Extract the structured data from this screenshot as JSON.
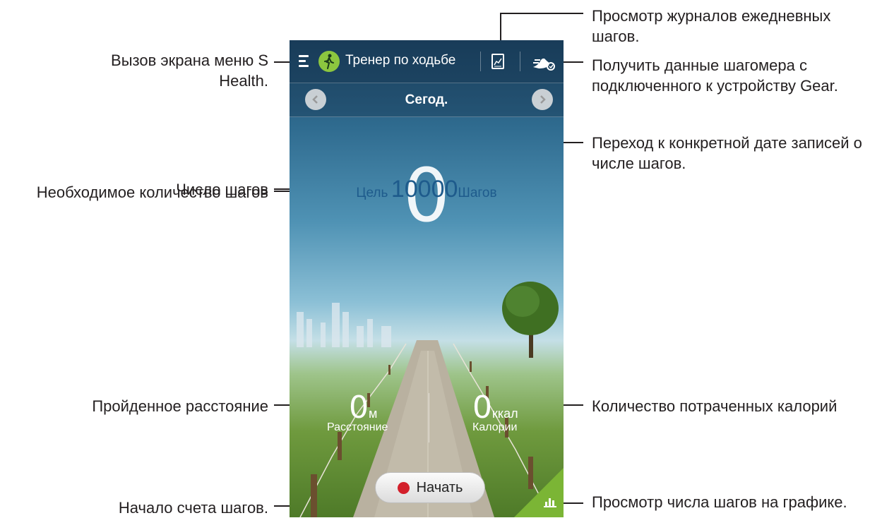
{
  "app": {
    "title": "Тренер по ходьбе",
    "date": "Сегод.",
    "step_count": "0",
    "goal_prefix": "Цель",
    "goal_value": "10000",
    "goal_unit": "Шагов",
    "distance_value": "0",
    "distance_unit": "м",
    "distance_label": "Расстояние",
    "calories_value": "0",
    "calories_unit": "ккал",
    "calories_label": "Калории",
    "start_label": "Начать",
    "prev_icon": "chevron-left-icon",
    "next_icon": "chevron-right-icon",
    "colors": {
      "accent_green": "#8cc63f",
      "record_red": "#d3202b",
      "goal_blue": "#1e5b8c"
    }
  },
  "annotations": {
    "menu": "Вызов экрана меню S Health.",
    "log": "Просмотр журналов ежедневных шагов.",
    "gear": "Получить данные шагомера с подключенного к устройству Gear.",
    "date": "Переход к конкретной дате записей о числе шагов.",
    "steps": "Число шагов",
    "goal": "Необходимое количество шагов",
    "distance": "Пройденное расстояние",
    "calories": "Количество потраченных калорий",
    "start": "Начало счета шагов.",
    "chart": "Просмотр числа шагов на графике."
  }
}
